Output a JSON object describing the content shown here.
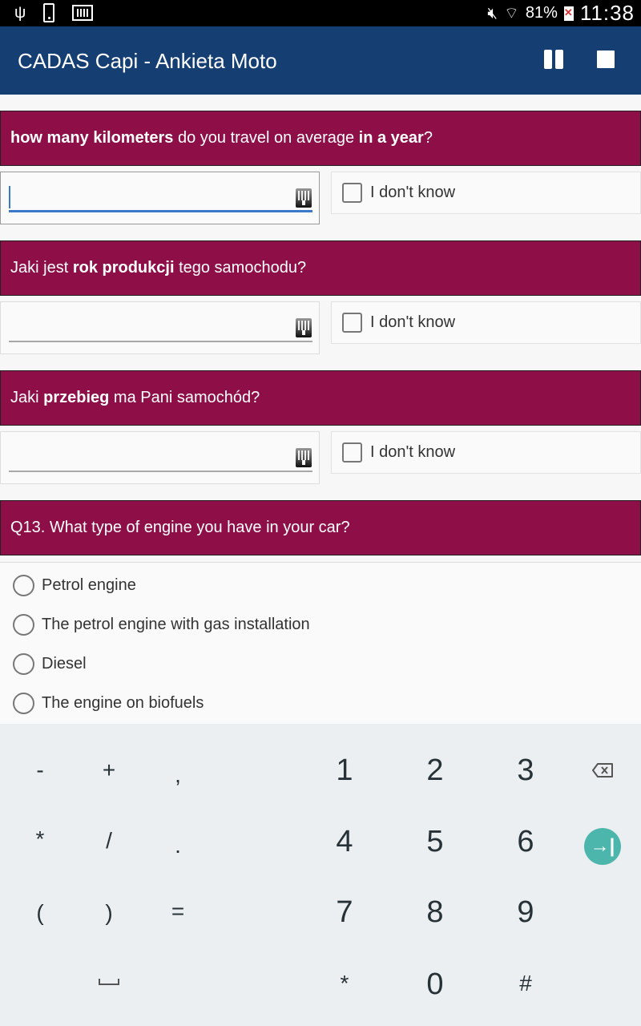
{
  "status_bar": {
    "left_icons": [
      "usb-icon",
      "phone-icon",
      "keyboard-icon"
    ],
    "usb_glyph": "ψ",
    "mute_glyph": "🔇",
    "wifi_glyph": "📶",
    "battery_percent": "81%",
    "time": "11:38"
  },
  "app_bar": {
    "title": "CADAS Capi - Ankieta Moto",
    "actions": [
      "pause",
      "stop"
    ],
    "color": "#153e73"
  },
  "questions": [
    {
      "parts": [
        {
          "text": "how many kilometers",
          "bold": true
        },
        {
          "text": " do you travel on average ",
          "bold": false
        },
        {
          "text": "in a year",
          "bold": true
        },
        {
          "text": "?",
          "bold": false
        }
      ],
      "input_value": "",
      "focused": true,
      "dont_know_label": "I don't know",
      "dont_know_checked": false
    },
    {
      "parts": [
        {
          "text": "Jaki jest ",
          "bold": false
        },
        {
          "text": "rok produkcji",
          "bold": true
        },
        {
          "text": " tego samochodu?",
          "bold": false
        }
      ],
      "input_value": "",
      "focused": false,
      "dont_know_label": "I don't know",
      "dont_know_checked": false
    },
    {
      "parts": [
        {
          "text": "Jaki ",
          "bold": false
        },
        {
          "text": "przebieg",
          "bold": true
        },
        {
          "text": " ma Pani samochód?",
          "bold": false
        }
      ],
      "input_value": "",
      "focused": false,
      "dont_know_label": "I don't know",
      "dont_know_checked": false
    }
  ],
  "q13": {
    "title": "Q13. What type of engine you have in your car?",
    "options": [
      {
        "label": "Petrol engine",
        "selected": false
      },
      {
        "label": "The petrol engine with gas installation",
        "selected": false
      },
      {
        "label": "Diesel",
        "selected": false
      },
      {
        "label": "The engine on biofuels",
        "selected": false
      }
    ]
  },
  "header_color": "#8e0f48",
  "keyboard": {
    "symbol_rows": [
      [
        "-",
        "+",
        ","
      ],
      [
        "*",
        "/",
        "."
      ],
      [
        "(",
        ")",
        "="
      ],
      [
        "",
        "␣",
        ""
      ]
    ],
    "digit_rows": [
      [
        "1",
        "2",
        "3"
      ],
      [
        "4",
        "5",
        "6"
      ],
      [
        "7",
        "8",
        "9"
      ],
      [
        "*",
        "0",
        "#"
      ]
    ],
    "action_keys": [
      "backspace",
      "next"
    ],
    "next_glyph": "→|",
    "accent": "#4db6ac"
  }
}
